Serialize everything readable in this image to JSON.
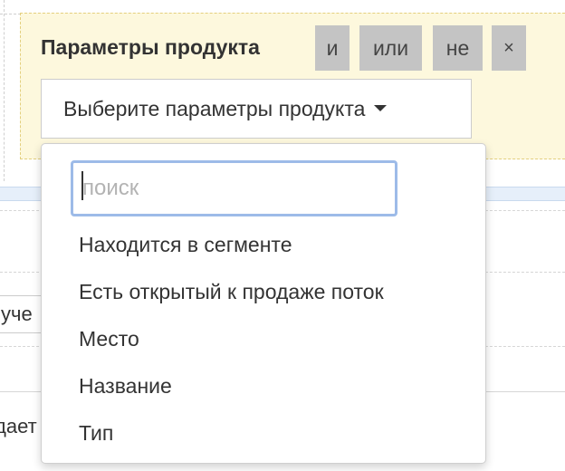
{
  "panel": {
    "title": "Параметры продукта",
    "operators": {
      "and": "и",
      "or": "или",
      "not": "не",
      "remove": "×"
    },
    "select_label": "Выберите параметры продукта"
  },
  "dropdown": {
    "search_placeholder": "поиск",
    "options": [
      "Находится в сегменте",
      "Есть открытый к продаже поток",
      "Место",
      "Название",
      "Тип"
    ]
  },
  "background": {
    "select_fragment": "уче",
    "text_fragment": "дает"
  },
  "colors": {
    "panel_bg": "#fdf8dd",
    "operator_bg": "#c4c4c4",
    "focus_border": "#9dbbe8"
  }
}
